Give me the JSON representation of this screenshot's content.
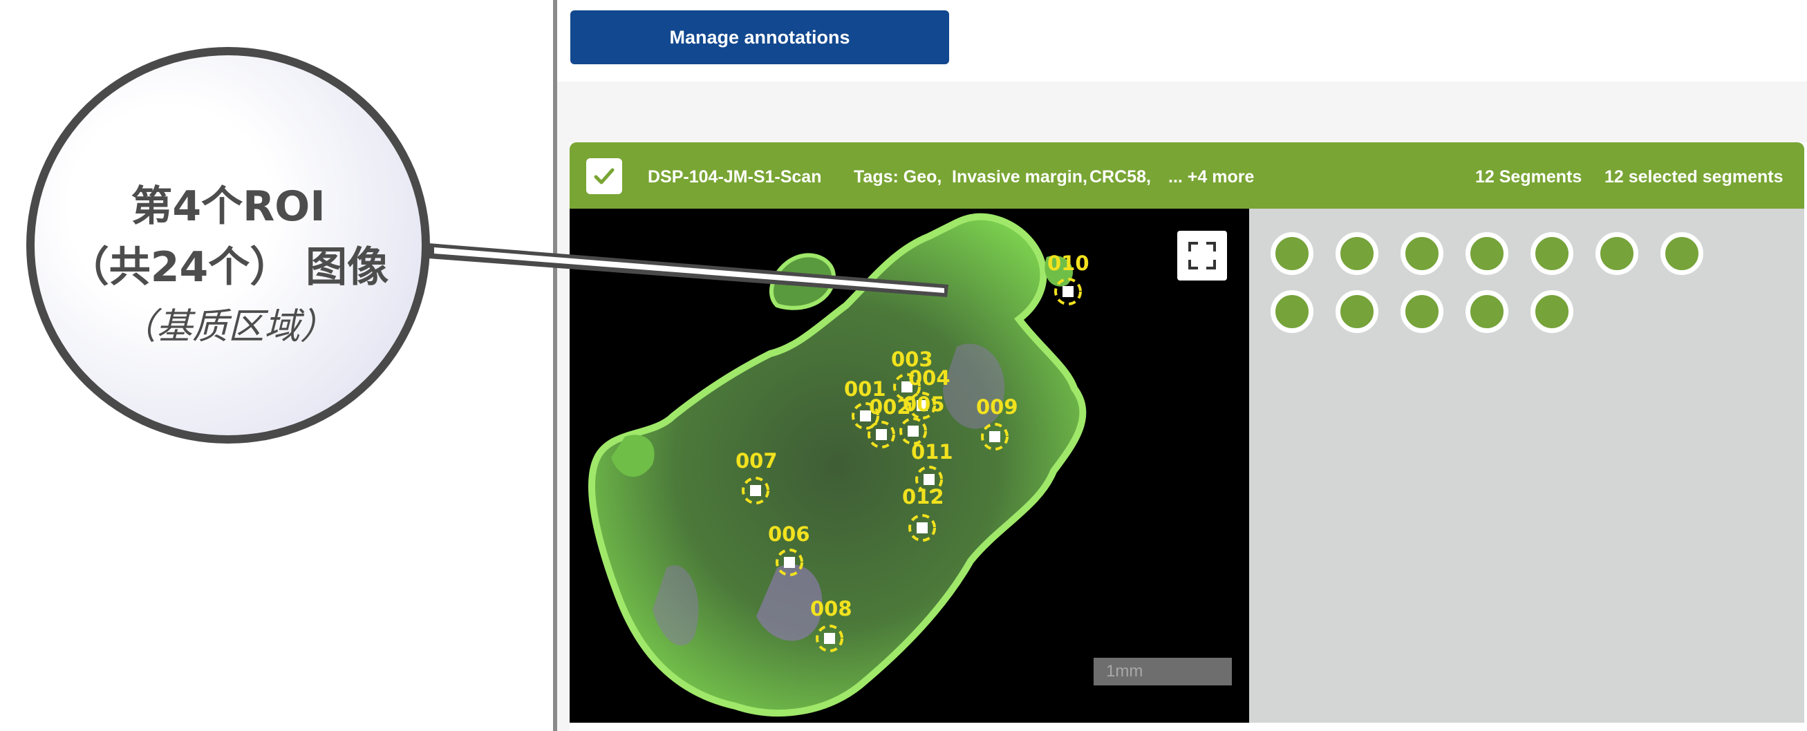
{
  "toolbar": {
    "manage_label": "Manage annotations"
  },
  "callout": {
    "line1": "第4个ROI",
    "line2": "（共24个） 图像",
    "line3": "（基质区域）"
  },
  "scan_card": {
    "name": "DSP-104-JM-S1-Scan",
    "tags_label": "Tags: Geo,",
    "tag_2": "Invasive margin,",
    "tag_3": "CRC58,",
    "more": "... +4 more",
    "segments": "12 Segments",
    "selected": "12 selected segments",
    "header_color": "#79a534"
  },
  "image": {
    "scale_label": "1mm",
    "roi_labels": [
      "010",
      "003",
      "001",
      "002",
      "004",
      "009",
      "005",
      "011",
      "007",
      "012",
      "006",
      "008"
    ]
  },
  "segment_dots": {
    "count": 12,
    "color": "#76a33a"
  }
}
